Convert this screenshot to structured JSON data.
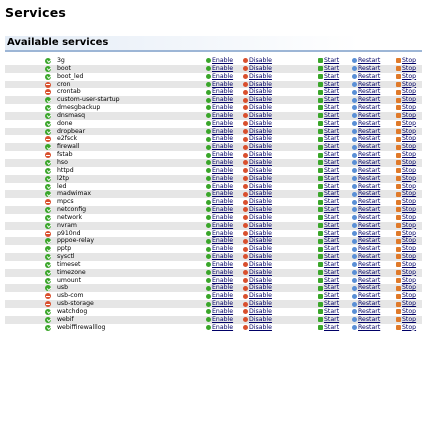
{
  "page": {
    "title": "Services"
  },
  "section": {
    "title": "Available services"
  },
  "actions": {
    "enable": "Enable",
    "disable": "Disable",
    "start": "Start",
    "restart": "Restart",
    "stop": "Stop"
  },
  "colors": {
    "status_ok": "#3aa62a",
    "status_error": "#d9502e",
    "link": "#000066",
    "row_alt": "#e6e6e6"
  },
  "services": [
    {
      "name": "3g",
      "status": "enabled"
    },
    {
      "name": "boot",
      "status": "enabled"
    },
    {
      "name": "boot_led",
      "status": "enabled"
    },
    {
      "name": "cron",
      "status": "disabled"
    },
    {
      "name": "crontab",
      "status": "disabled"
    },
    {
      "name": "custom-user-startup",
      "status": "enabled"
    },
    {
      "name": "dmesgbackup",
      "status": "enabled"
    },
    {
      "name": "dnsmasq",
      "status": "enabled"
    },
    {
      "name": "done",
      "status": "enabled"
    },
    {
      "name": "dropbear",
      "status": "enabled"
    },
    {
      "name": "e2fsck",
      "status": "disabled"
    },
    {
      "name": "firewall",
      "status": "enabled"
    },
    {
      "name": "fstab",
      "status": "disabled"
    },
    {
      "name": "hso",
      "status": "enabled"
    },
    {
      "name": "httpd",
      "status": "enabled"
    },
    {
      "name": "l2tp",
      "status": "enabled"
    },
    {
      "name": "led",
      "status": "enabled"
    },
    {
      "name": "madwimax",
      "status": "enabled"
    },
    {
      "name": "mpcs",
      "status": "disabled"
    },
    {
      "name": "netconfig",
      "status": "enabled"
    },
    {
      "name": "network",
      "status": "enabled"
    },
    {
      "name": "nvram",
      "status": "enabled"
    },
    {
      "name": "p910nd",
      "status": "disabled"
    },
    {
      "name": "pppoe-relay",
      "status": "enabled"
    },
    {
      "name": "pptp",
      "status": "enabled"
    },
    {
      "name": "sysctl",
      "status": "enabled"
    },
    {
      "name": "timeset",
      "status": "enabled"
    },
    {
      "name": "timezone",
      "status": "enabled"
    },
    {
      "name": "umount",
      "status": "enabled"
    },
    {
      "name": "usb",
      "status": "enabled"
    },
    {
      "name": "usb-com",
      "status": "disabled"
    },
    {
      "name": "usb-storage",
      "status": "disabled"
    },
    {
      "name": "watchdog",
      "status": "enabled"
    },
    {
      "name": "webif",
      "status": "enabled"
    },
    {
      "name": "webiffirewalllog",
      "status": "enabled"
    }
  ]
}
